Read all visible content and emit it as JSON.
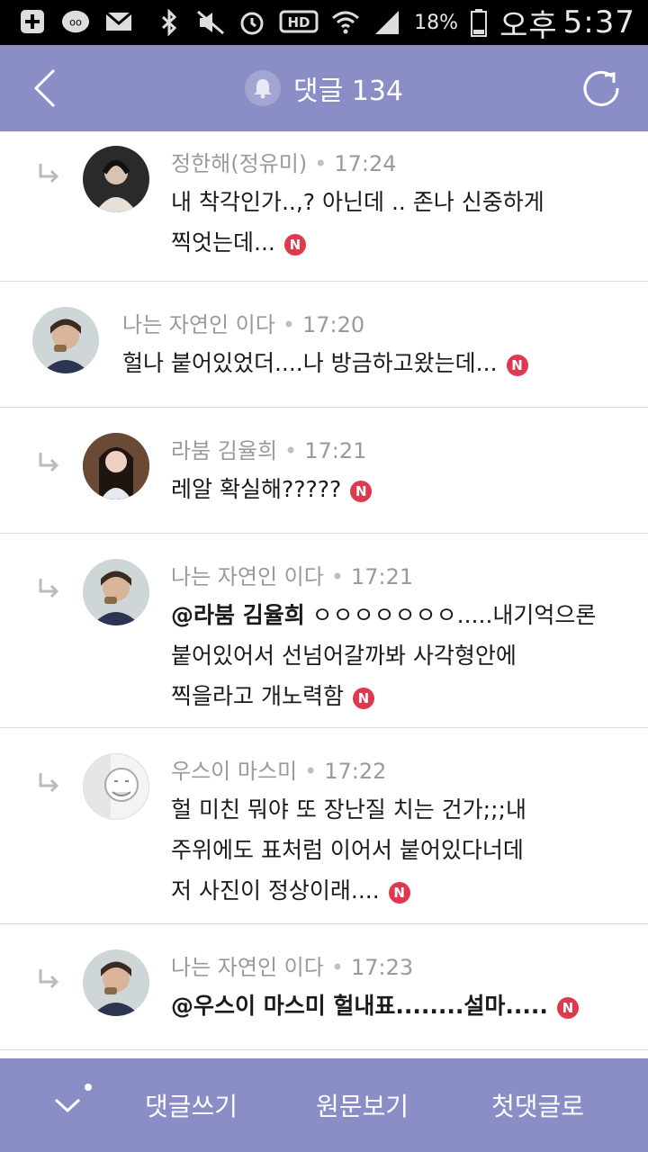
{
  "status_bar": {
    "battery": "18%",
    "ampm": "오후",
    "time": "5:37",
    "icons": [
      "add-icon",
      "app-icon",
      "mail-icon",
      "bluetooth-icon",
      "mute-icon",
      "alarm-icon",
      "hd-icon",
      "wifi-icon",
      "signal-icon",
      "battery-icon"
    ]
  },
  "header": {
    "title": "댓글 134",
    "accent": "#8b8ec6"
  },
  "comments": [
    {
      "author": "정한해(정유미)",
      "time": "17:24",
      "lines": [
        "내 착각인가..,? 아닌데 .. 존나 신중하게",
        "찍엇는데..."
      ],
      "badge": "N",
      "reply": true
    },
    {
      "author": "나는 자연인 이다",
      "time": "17:20",
      "lines": [
        "헐나 붙어있었더....나 방금하고왔는데..."
      ],
      "badge": "N",
      "reply": false
    },
    {
      "author": "라붐 김율희",
      "time": "17:21",
      "lines": [
        "레알 확실해?????"
      ],
      "badge": "N",
      "reply": true
    },
    {
      "author": "나는 자연인 이다",
      "time": "17:21",
      "mention": "@라붐 김율희",
      "lines": [
        " ㅇㅇㅇㅇㅇㅇㅇ.....내기억으론",
        "붙어있어서 선넘어갈까봐 사각형안에",
        "찍을라고 개노력함"
      ],
      "badge": "N",
      "reply": true
    },
    {
      "author": "우스이 마스미",
      "time": "17:22",
      "lines": [
        "헐 미친 뭐야 또 장난질 치는 건가;;;내",
        "주위에도 표처럼 이어서 붙어있다너데",
        "저 사진이 정상이래...."
      ],
      "badge": "N",
      "reply": true
    },
    {
      "author": "나는 자연인 이다",
      "time": "17:23",
      "mention": "@우스이 마스미",
      "lines": [
        " 헐내표........설마....."
      ],
      "badge": "N",
      "reply": true
    }
  ],
  "bottom_bar": {
    "collapse_icon": "chevron-down-icon",
    "write": "댓글쓰기",
    "original": "원문보기",
    "first": "첫댓글로"
  }
}
